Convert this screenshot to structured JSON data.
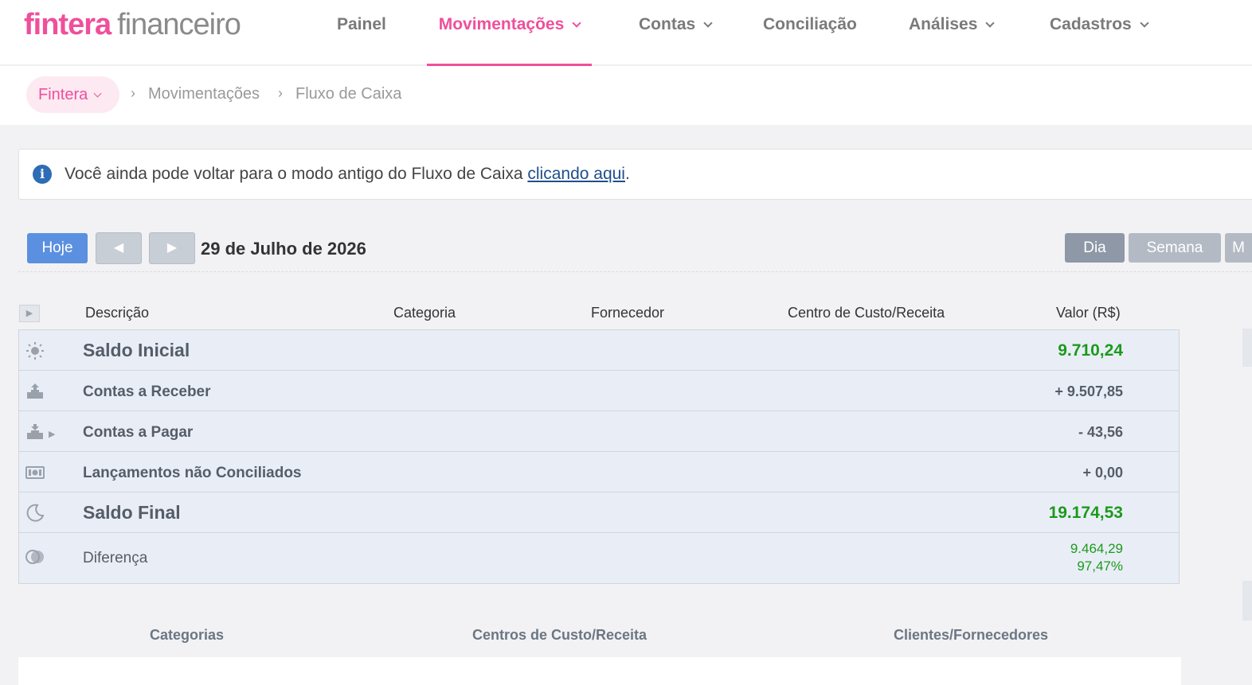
{
  "logo": {
    "brand": "fintera",
    "product": "financeiro"
  },
  "nav": {
    "items": [
      {
        "label": "Painel"
      },
      {
        "label": "Movimentações"
      },
      {
        "label": "Contas"
      },
      {
        "label": "Conciliação"
      },
      {
        "label": "Análises"
      },
      {
        "label": "Cadastros"
      }
    ]
  },
  "breadcrumb": {
    "company": "Fintera",
    "items": [
      "Movimentações",
      "Fluxo de Caixa"
    ]
  },
  "notice": {
    "text": "Você ainda pode voltar para o modo antigo do Fluxo de Caixa ",
    "link": "clicando aqui",
    "end": "."
  },
  "toolbar": {
    "today": "Hoje",
    "prev": "◀",
    "next": "▶",
    "date": "29 de Julho de 2026",
    "periods": [
      "Dia",
      "Semana",
      "M"
    ]
  },
  "table": {
    "columns": [
      "Descrição",
      "Categoria",
      "Fornecedor",
      "Centro de Custo/Receita",
      "Valor (R$)"
    ],
    "rows": [
      {
        "label": "Saldo Inicial",
        "value": "9.710,24"
      },
      {
        "label": "Contas a Receber",
        "value": "+ 9.507,85"
      },
      {
        "label": "Contas a Pagar",
        "value": "- 43,56"
      },
      {
        "label": "Lançamentos não Conciliados",
        "value": "+ 0,00"
      },
      {
        "label": "Saldo Final",
        "value": "19.174,53"
      },
      {
        "label": "Diferença",
        "value": "9.464,29",
        "percent": "97,47%"
      }
    ]
  },
  "summary_tabs": [
    "Categorias",
    "Centros de Custo/Receita",
    "Clientes/Fornecedores"
  ],
  "colors": {
    "brand": "#ef4f9b",
    "primary_button": "#5b8fe0",
    "positive": "#1c9a1c"
  }
}
